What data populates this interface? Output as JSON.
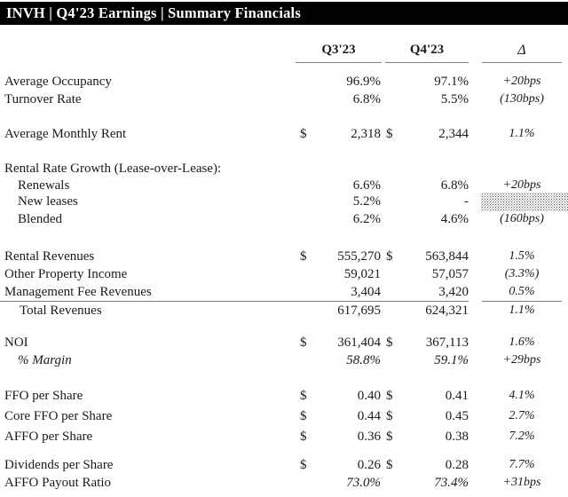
{
  "header": {
    "title": "INVH  |  Q4'23 Earnings  |  Summary Financials"
  },
  "table": {
    "columns": {
      "label": "",
      "q3": "Q3'23",
      "q4": "Q4'23",
      "delta": "Δ"
    },
    "rows": [
      {
        "label": "Average Occupancy",
        "q3": "96.9%",
        "q4": "97.1%",
        "delta": "+20bps"
      },
      {
        "label": "Turnover Rate",
        "q3": "6.8%",
        "q4": "5.5%",
        "delta": "(130bps)"
      },
      {
        "label": "Average Monthly Rent",
        "cur1": "$",
        "q3": "2,318",
        "cur2": "$",
        "q4": "2,344",
        "delta": "1.1%"
      },
      {
        "label": "Rental Rate Growth (Lease-over-Lease):",
        "q3": "",
        "q4": "",
        "delta": ""
      },
      {
        "label": "Renewals",
        "q3": "6.6%",
        "q4": "6.8%",
        "delta": "+20bps"
      },
      {
        "label": "New leases",
        "q3": "5.2%",
        "q4": "-",
        "delta": ""
      },
      {
        "label": "Blended",
        "q3": "6.2%",
        "q4": "4.6%",
        "delta": "(160bps)"
      },
      {
        "label": "Rental Revenues",
        "cur1": "$",
        "q3": "555,270",
        "cur2": "$",
        "q4": "563,844",
        "delta": "1.5%"
      },
      {
        "label": "Other Property Income",
        "q3": "59,021",
        "q4": "57,057",
        "delta": "(3.3%)"
      },
      {
        "label": "Management Fee Revenues",
        "q3": "3,404",
        "q4": "3,420",
        "delta": "0.5%"
      },
      {
        "label": "Total Revenues",
        "q3": "617,695",
        "q4": "624,321",
        "delta": "1.1%"
      },
      {
        "label": "NOI",
        "cur1": "$",
        "q3": "361,404",
        "cur2": "$",
        "q4": "367,113",
        "delta": "1.6%"
      },
      {
        "label": "% Margin",
        "q3": "58.8%",
        "q4": "59.1%",
        "delta": "+29bps"
      },
      {
        "label": "FFO per Share",
        "cur1": "$",
        "q3": "0.40",
        "cur2": "$",
        "q4": "0.41",
        "delta": "4.1%"
      },
      {
        "label": "Core FFO per Share",
        "cur1": "$",
        "q3": "0.44",
        "cur2": "$",
        "q4": "0.45",
        "delta": "2.7%"
      },
      {
        "label": "AFFO per Share",
        "cur1": "$",
        "q3": "0.36",
        "cur2": "$",
        "q4": "0.38",
        "delta": "7.2%"
      },
      {
        "label": "Dividends per Share",
        "cur1": "$",
        "q3": "0.26",
        "cur2": "$",
        "q4": "0.28",
        "delta": "7.7%"
      },
      {
        "label": "AFFO Payout Ratio",
        "q3": "73.0%",
        "q4": "73.4%",
        "delta": "+31bps"
      }
    ]
  }
}
